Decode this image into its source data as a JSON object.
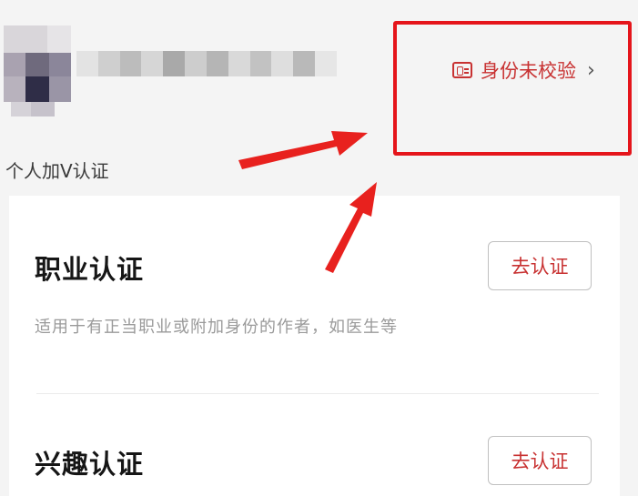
{
  "profile": {
    "verify_status": "身份未校验",
    "chevron": "›",
    "id_icon": "id-card-icon",
    "accent_color": "#c83232",
    "highlight_color": "#e5151b"
  },
  "section": {
    "label": "个人加V认证"
  },
  "items": [
    {
      "title": "职业认证",
      "description": "适用于有正当职业或附加身份的作者，如医生等",
      "button": "去认证"
    },
    {
      "title": "兴趣认证",
      "button": "去认证"
    }
  ]
}
